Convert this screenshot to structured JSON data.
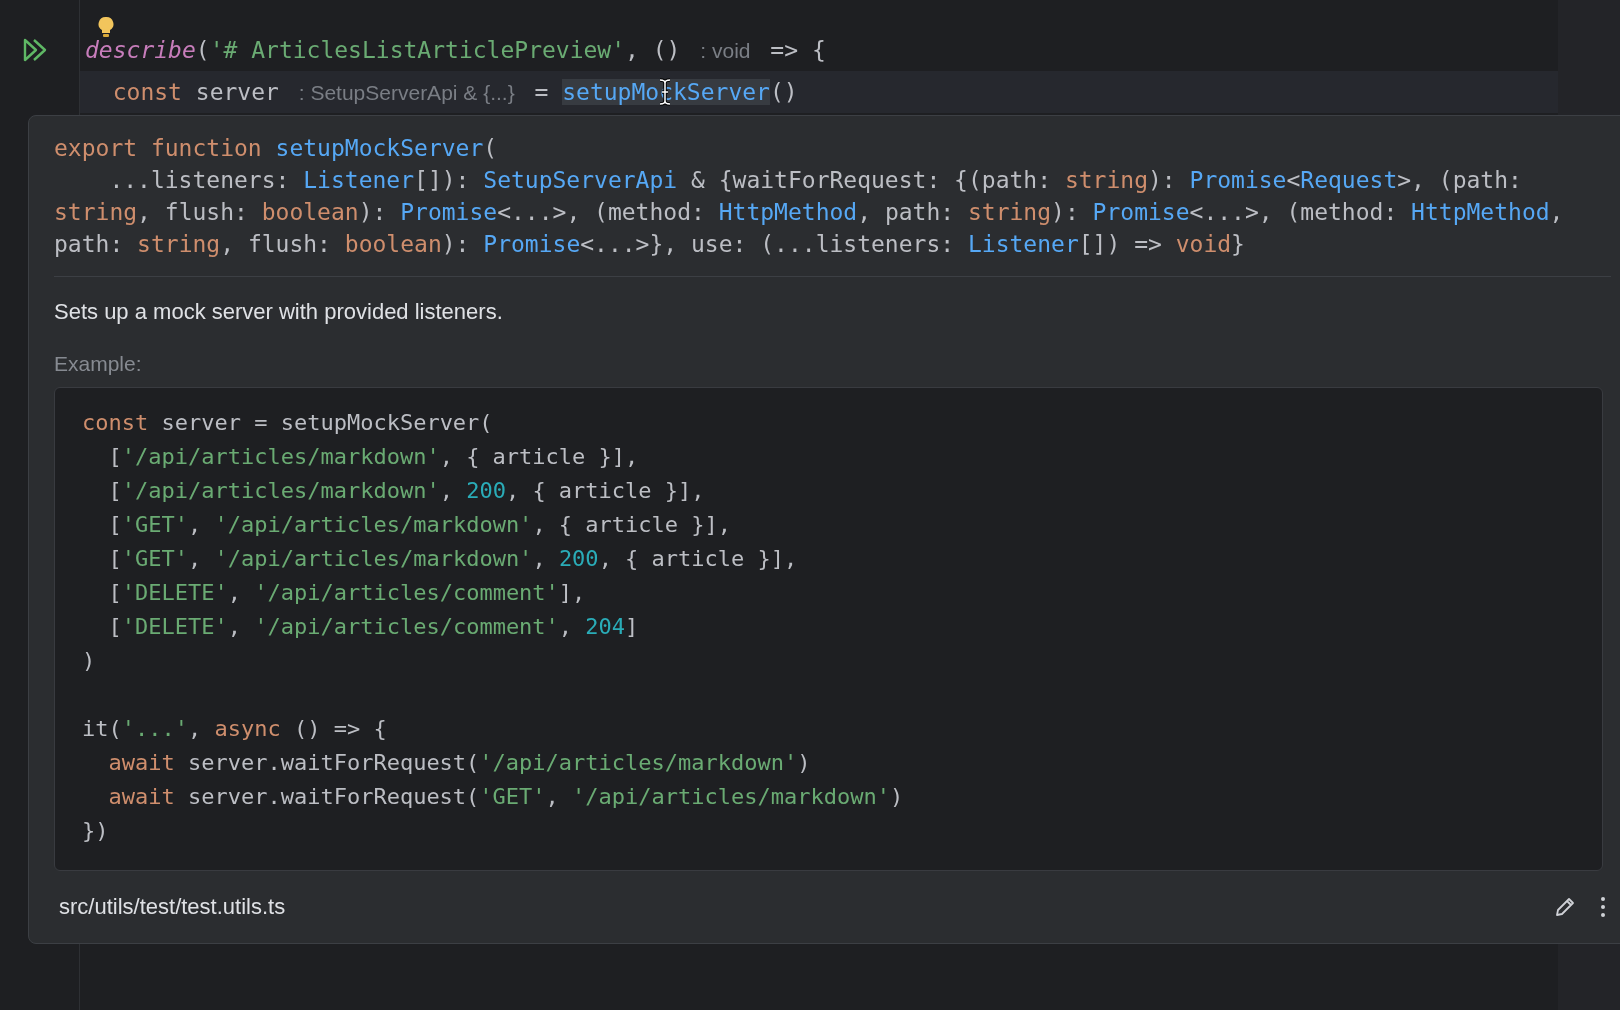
{
  "editor": {
    "lines": [
      {
        "run_button": true,
        "bulb": true,
        "current": false,
        "tokens": [
          {
            "text": "describe",
            "kind": "call"
          },
          {
            "text": "(",
            "kind": "plain"
          },
          {
            "text": "'# ArticlesListArticlePreview'",
            "kind": "string"
          },
          {
            "text": ", () ",
            "kind": "plain"
          },
          {
            "text": ": void",
            "kind": "hint"
          },
          {
            "text": " => {",
            "kind": "plain"
          }
        ]
      },
      {
        "current": true,
        "tokens": [
          {
            "text": "  const",
            "kind": "keyword"
          },
          {
            "text": " server ",
            "kind": "plain"
          },
          {
            "text": ": SetupServerApi & {...}",
            "kind": "hint"
          },
          {
            "text": " = ",
            "kind": "plain"
          },
          {
            "text": "setupMockServer",
            "kind": "usage"
          },
          {
            "text": "()",
            "kind": "plain"
          }
        ]
      }
    ]
  },
  "popup": {
    "signature": [
      [
        {
          "text": "export function ",
          "kind": "keyword"
        },
        {
          "text": "setupMockServer",
          "kind": "type"
        },
        {
          "text": "(",
          "kind": "plain"
        }
      ],
      [
        {
          "text": "    ...listeners: ",
          "kind": "plain"
        },
        {
          "text": "Listener",
          "kind": "type"
        },
        {
          "text": "[]): ",
          "kind": "plain"
        },
        {
          "text": "SetupServerApi",
          "kind": "type"
        },
        {
          "text": " & {waitForRequest: {(path: ",
          "kind": "plain"
        },
        {
          "text": "string",
          "kind": "keyword"
        },
        {
          "text": "): ",
          "kind": "plain"
        },
        {
          "text": "Promise",
          "kind": "type"
        },
        {
          "text": "<",
          "kind": "plain"
        },
        {
          "text": "Request",
          "kind": "type"
        },
        {
          "text": ">, (path:",
          "kind": "plain"
        }
      ],
      [
        {
          "text": "string",
          "kind": "keyword"
        },
        {
          "text": ", flush: ",
          "kind": "plain"
        },
        {
          "text": "boolean",
          "kind": "keyword"
        },
        {
          "text": "): ",
          "kind": "plain"
        },
        {
          "text": "Promise",
          "kind": "type"
        },
        {
          "text": "<...>, (method: ",
          "kind": "plain"
        },
        {
          "text": "HttpMethod",
          "kind": "type"
        },
        {
          "text": ", path: ",
          "kind": "plain"
        },
        {
          "text": "string",
          "kind": "keyword"
        },
        {
          "text": "): ",
          "kind": "plain"
        },
        {
          "text": "Promise",
          "kind": "type"
        },
        {
          "text": "<...>, (method: ",
          "kind": "plain"
        },
        {
          "text": "HttpMethod",
          "kind": "type"
        },
        {
          "text": ",",
          "kind": "plain"
        }
      ],
      [
        {
          "text": "path: ",
          "kind": "plain"
        },
        {
          "text": "string",
          "kind": "keyword"
        },
        {
          "text": ", flush: ",
          "kind": "plain"
        },
        {
          "text": "boolean",
          "kind": "keyword"
        },
        {
          "text": "): ",
          "kind": "plain"
        },
        {
          "text": "Promise",
          "kind": "type"
        },
        {
          "text": "<...>}, use: (...listeners: ",
          "kind": "plain"
        },
        {
          "text": "Listener",
          "kind": "type"
        },
        {
          "text": "[]) => ",
          "kind": "plain"
        },
        {
          "text": "void",
          "kind": "keyword"
        },
        {
          "text": "}",
          "kind": "plain"
        }
      ]
    ],
    "description": "Sets up a mock server with provided listeners.",
    "example_label": "Example:",
    "example_blocks": [
      [
        [
          {
            "text": "const",
            "kind": "keyword"
          },
          {
            "text": " server = setupMockServer(",
            "kind": "plain"
          }
        ],
        [
          {
            "text": "  [",
            "kind": "plain"
          },
          {
            "text": "'/api/articles/markdown'",
            "kind": "string"
          },
          {
            "text": ", { article }],",
            "kind": "plain"
          }
        ],
        [
          {
            "text": "  [",
            "kind": "plain"
          },
          {
            "text": "'/api/articles/markdown'",
            "kind": "string"
          },
          {
            "text": ", ",
            "kind": "plain"
          },
          {
            "text": "200",
            "kind": "number"
          },
          {
            "text": ", { article }],",
            "kind": "plain"
          }
        ],
        [
          {
            "text": "  [",
            "kind": "plain"
          },
          {
            "text": "'GET'",
            "kind": "string"
          },
          {
            "text": ", ",
            "kind": "plain"
          },
          {
            "text": "'/api/articles/markdown'",
            "kind": "string"
          },
          {
            "text": ", { article }],",
            "kind": "plain"
          }
        ],
        [
          {
            "text": "  [",
            "kind": "plain"
          },
          {
            "text": "'GET'",
            "kind": "string"
          },
          {
            "text": ", ",
            "kind": "plain"
          },
          {
            "text": "'/api/articles/markdown'",
            "kind": "string"
          },
          {
            "text": ", ",
            "kind": "plain"
          },
          {
            "text": "200",
            "kind": "number"
          },
          {
            "text": ", { article }],",
            "kind": "plain"
          }
        ],
        [
          {
            "text": "  [",
            "kind": "plain"
          },
          {
            "text": "'DELETE'",
            "kind": "string"
          },
          {
            "text": ", ",
            "kind": "plain"
          },
          {
            "text": "'/api/articles/comment'",
            "kind": "string"
          },
          {
            "text": "],",
            "kind": "plain"
          }
        ],
        [
          {
            "text": "  [",
            "kind": "plain"
          },
          {
            "text": "'DELETE'",
            "kind": "string"
          },
          {
            "text": ", ",
            "kind": "plain"
          },
          {
            "text": "'/api/articles/comment'",
            "kind": "string"
          },
          {
            "text": ", ",
            "kind": "plain"
          },
          {
            "text": "204",
            "kind": "number"
          },
          {
            "text": "]",
            "kind": "plain"
          }
        ],
        [
          {
            "text": ")",
            "kind": "plain"
          }
        ]
      ],
      [
        [
          {
            "text": "it(",
            "kind": "plain"
          },
          {
            "text": "'...'",
            "kind": "string"
          },
          {
            "text": ", ",
            "kind": "plain"
          },
          {
            "text": "async",
            "kind": "keyword"
          },
          {
            "text": " () => {",
            "kind": "plain"
          }
        ],
        [
          {
            "text": "  await",
            "kind": "keyword"
          },
          {
            "text": " server.waitForRequest(",
            "kind": "plain"
          },
          {
            "text": "'/api/articles/markdown'",
            "kind": "string"
          },
          {
            "text": ")",
            "kind": "plain"
          }
        ],
        [
          {
            "text": "  await",
            "kind": "keyword"
          },
          {
            "text": " server.waitForRequest(",
            "kind": "plain"
          },
          {
            "text": "'GET'",
            "kind": "string"
          },
          {
            "text": ", ",
            "kind": "plain"
          },
          {
            "text": "'/api/articles/markdown'",
            "kind": "string"
          },
          {
            "text": ")",
            "kind": "plain"
          }
        ],
        [
          {
            "text": "})",
            "kind": "plain"
          }
        ]
      ]
    ],
    "file_path": "src/utils/test/test.utils.ts"
  }
}
